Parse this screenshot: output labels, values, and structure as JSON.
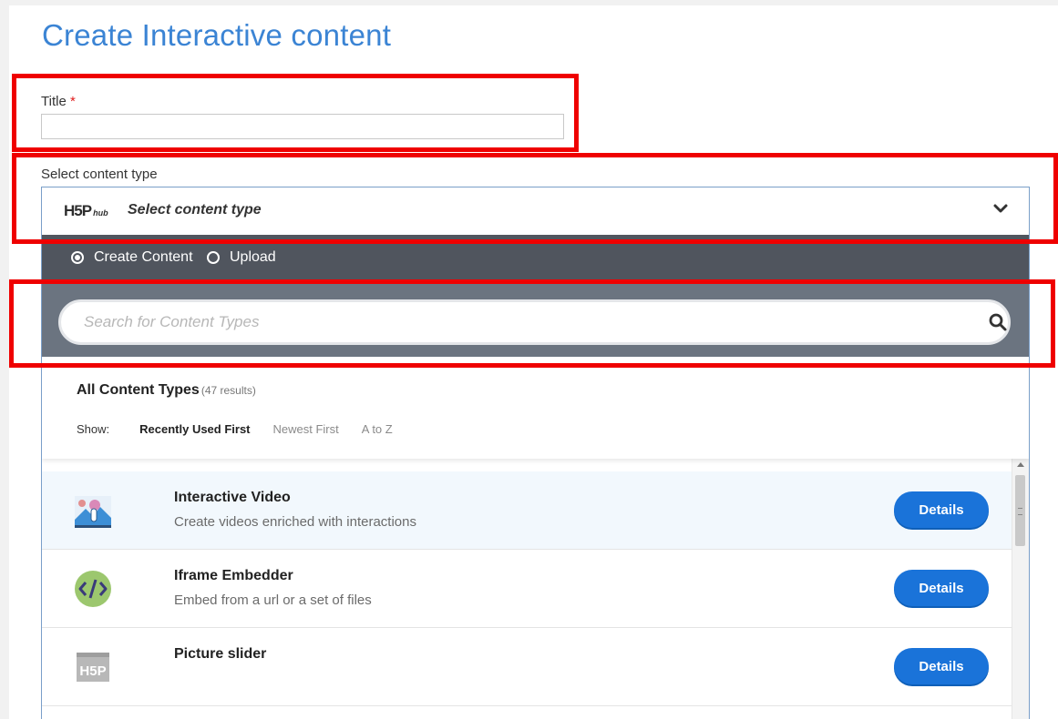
{
  "page": {
    "title": "Create Interactive content"
  },
  "title_field": {
    "label": "Title",
    "required_mark": "*",
    "value": "",
    "placeholder": ""
  },
  "content_type": {
    "label": "Select content type",
    "hub_logo": {
      "mark": "H5P",
      "suffix": "hub"
    },
    "selector_text": "Select content type",
    "chevron_icon": "chevron-down-icon"
  },
  "tabs": [
    {
      "label": "Create Content",
      "selected": true
    },
    {
      "label": "Upload",
      "selected": false
    }
  ],
  "search": {
    "placeholder": "Search for Content Types",
    "icon": "search-icon"
  },
  "results": {
    "title": "All Content Types",
    "count": "(47 results)",
    "show_label": "Show:",
    "sort_options": [
      "Recently Used First",
      "Newest First",
      "A to Z"
    ],
    "active_sort": "Recently Used First"
  },
  "items": [
    {
      "name": "Interactive Video",
      "description": "Create videos enriched with interactions",
      "button": "Details",
      "icon": "interactive-video-icon"
    },
    {
      "name": "Iframe Embedder",
      "description": "Embed from a url or a set of files",
      "button": "Details",
      "icon": "code-icon"
    },
    {
      "name": "Picture slider",
      "description": "",
      "button": "Details",
      "icon": "h5p-icon"
    }
  ],
  "colors": {
    "accent": "#3b84d4",
    "button": "#1a73d9",
    "tab_bar": "#50555e",
    "search_bar": "#6b7480",
    "annotation": "#ef0000"
  }
}
